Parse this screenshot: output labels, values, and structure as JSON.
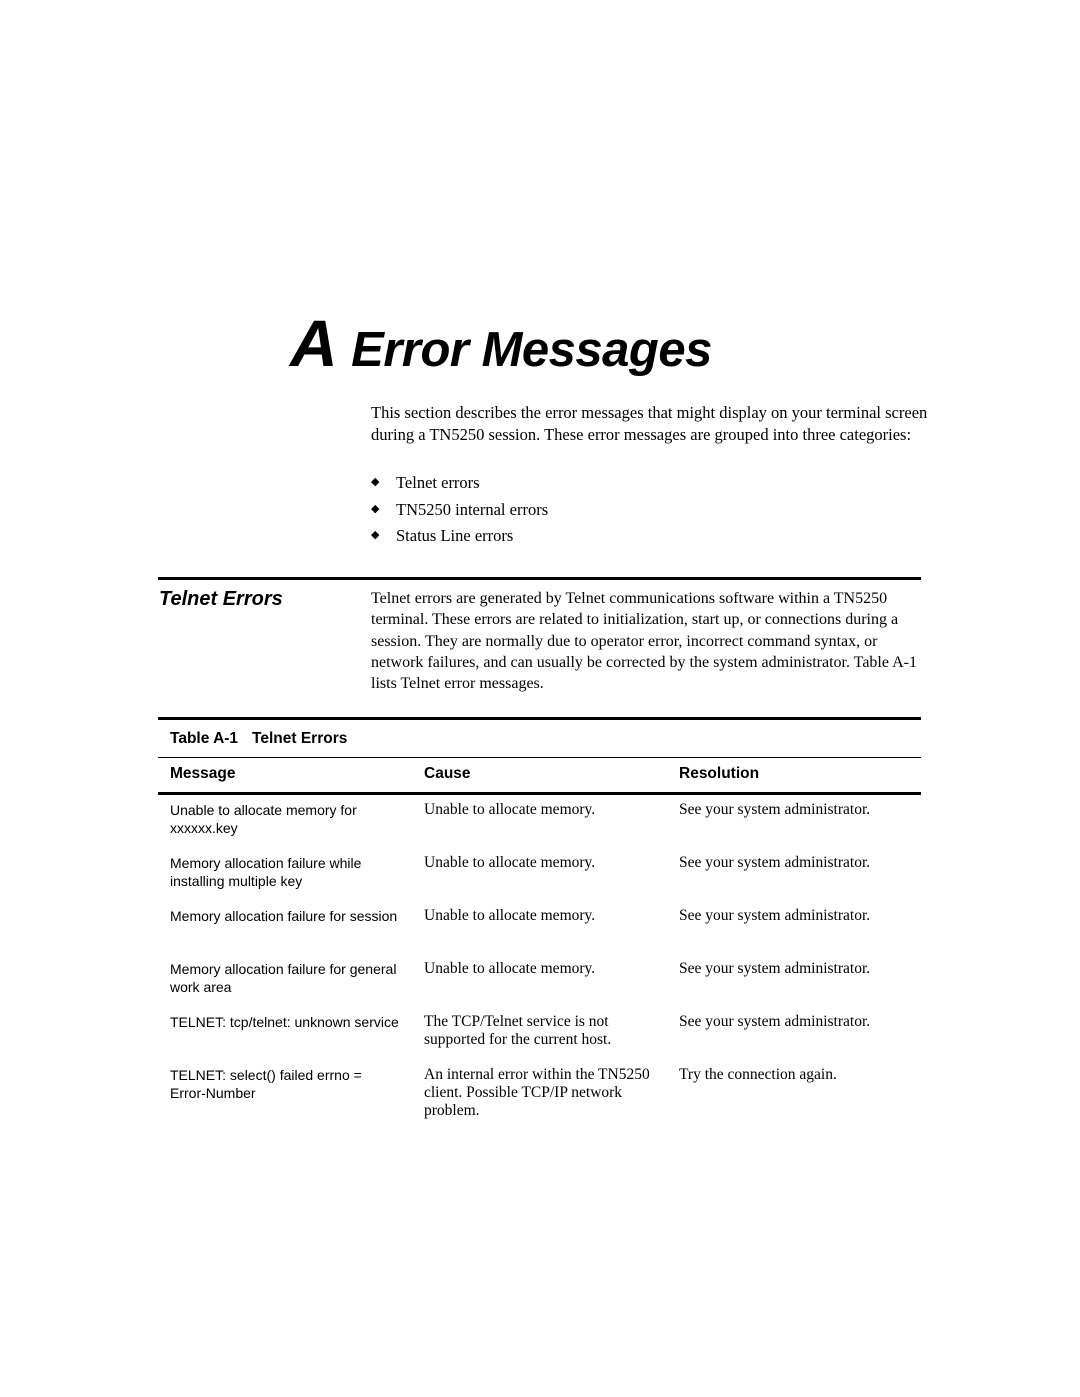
{
  "chapter": {
    "letter": "A",
    "title": "Error Messages"
  },
  "intro": {
    "text": "This section describes the error messages that might display on your terminal screen during a TN5250 session. These error messages are grouped into three categories:",
    "bullet_icon": "◆",
    "bullets": [
      "Telnet errors",
      "TN5250 internal errors",
      "Status Line errors"
    ]
  },
  "section": {
    "heading": "Telnet Errors",
    "body": "Telnet errors are generated by Telnet communications software within a TN5250 terminal. These errors are related to initialization, start up, or connections during a session. They are normally due to operator error, incorrect command syntax, or network failures, and can usually be corrected by the system administrator. Table A-1 lists Telnet error messages."
  },
  "table": {
    "caption_number": "Table A-1",
    "caption_title": "Telnet Errors",
    "columns": [
      "Message",
      "Cause",
      "Resolution"
    ],
    "rows": [
      {
        "message": "Unable to allocate memory for xxxxxx.key",
        "cause": "Unable to allocate memory.",
        "resolution": "See your system administrator."
      },
      {
        "message": "Memory allocation failure while installing multiple key",
        "cause": "Unable to allocate memory.",
        "resolution": "See your system administrator."
      },
      {
        "message": "Memory allocation failure for session",
        "cause": "Unable to allocate memory.",
        "resolution": "See your system administrator."
      },
      {
        "message": "Memory allocation failure for general work area",
        "cause": "Unable to allocate memory.",
        "resolution": "See your system administrator."
      },
      {
        "message": "TELNET: tcp/telnet: unknown service",
        "cause": "The TCP/Telnet service is not supported for the current host.",
        "resolution": "See your system administrator."
      },
      {
        "message": "TELNET: select() failed errno = Error-Number",
        "cause": "An internal error within the TN5250 client. Possible TCP/IP network problem.",
        "resolution": "Try the connection again."
      }
    ]
  }
}
